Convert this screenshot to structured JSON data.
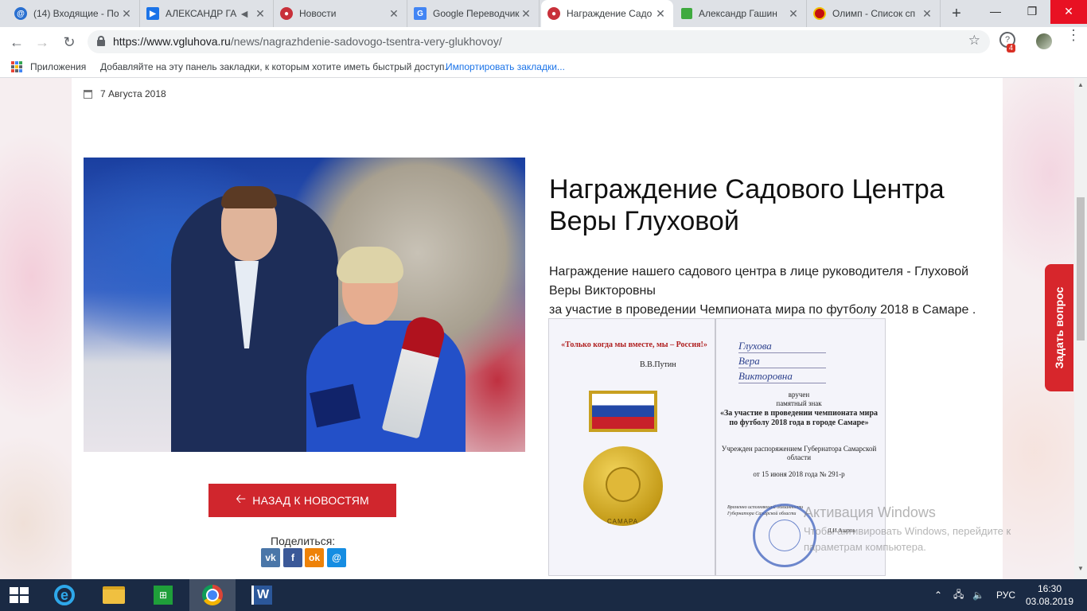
{
  "browser": {
    "tabs": [
      {
        "title": "(14) Входящие - По",
        "icon": "mail-at-icon",
        "color": "#2a70d0"
      },
      {
        "title": "АЛЕКСАНДР ГА",
        "icon": "play-icon",
        "color": "#1a73e8"
      },
      {
        "title": "Новости",
        "icon": "site-logo-icon",
        "color": "#c8303a"
      },
      {
        "title": "Google Переводчик",
        "icon": "translate-icon",
        "color": "#4285f4"
      },
      {
        "title": "Награждение Садо",
        "icon": "site-logo-icon",
        "color": "#c8303a"
      },
      {
        "title": "Александр Гашин",
        "icon": "green-square-icon",
        "color": "#3faa3f"
      },
      {
        "title": "Олимп - Список сп",
        "icon": "olimp-icon",
        "color": "#c41010"
      }
    ],
    "active_tab": 4,
    "url_host": "https://www.vgluhova.ru",
    "url_path": "/news/nagrazhdenie-sadovogo-tsentra-very-glukhovoy/",
    "extension_badge": "4",
    "bookmarks": {
      "apps_label": "Приложения",
      "hint": "Добавляйте на эту панель закладки, к которым хотите иметь быстрый доступ.",
      "import_link": "Импортировать закладки..."
    }
  },
  "article": {
    "date": "7 Августа 2018",
    "title": "Награждение Садового Центра Веры Глуховой",
    "paragraph_1": "Награждение нашего садового центра в лице руководителя - Глуховой Веры Викторовны",
    "paragraph_2": "за участие в проведении Чемпионата мира по футболу 2018 в Самаре .",
    "back_button": "НАЗАД К НОВОСТЯМ",
    "share_label": "Поделиться:",
    "share_buttons": [
      {
        "name": "vk",
        "label": "vk",
        "color": "#4a76a8"
      },
      {
        "name": "facebook",
        "label": "f",
        "color": "#3b5998"
      },
      {
        "name": "odnoklassniki",
        "label": "ok",
        "color": "#ee8208"
      },
      {
        "name": "moimir",
        "label": "@",
        "color": "#168de2"
      }
    ],
    "ask_question": "Задать вопрос"
  },
  "certificate": {
    "quote": "«Только когда мы вместе, мы – Россия!»",
    "quote_author": "В.В.Путин",
    "surname": "Глухова",
    "name": "Вера",
    "patronymic": "Викторовна",
    "line_awarded": "вручен",
    "line_badge": "памятный знак",
    "line_title": "«За участие в проведении чемпионата мира по футболу 2018 года в городе Самаре»",
    "line_established": "Учрежден распоряжением Губернатора Самарской области",
    "line_date": "от 15 июня 2018 года № 291-р",
    "small_print": "Временно исполняющий обязанности Губернатора Самарской области",
    "signature": "Д.И.Азаров",
    "medal_text": "САМАРА"
  },
  "os": {
    "watermark_title": "Активация Windows",
    "watermark_text": "Чтобы активировать Windows, перейдите к параметрам компьютера.",
    "language": "РУС",
    "time": "16:30",
    "date": "03.08.2019"
  }
}
